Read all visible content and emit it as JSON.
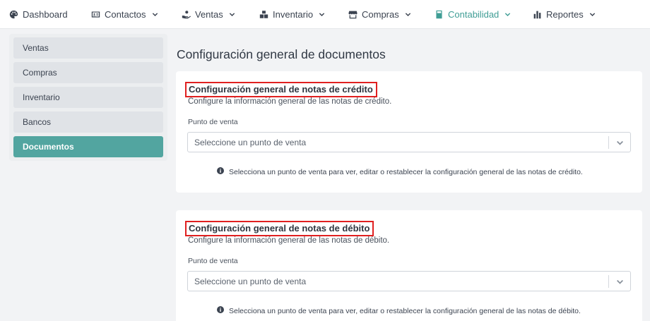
{
  "nav": {
    "items": [
      {
        "label": "Dashboard",
        "icon": "palette-icon",
        "has_dropdown": false
      },
      {
        "label": "Contactos",
        "icon": "contact-card-icon",
        "has_dropdown": true
      },
      {
        "label": "Ventas",
        "icon": "hand-coin-icon",
        "has_dropdown": true
      },
      {
        "label": "Inventario",
        "icon": "boxes-icon",
        "has_dropdown": true
      },
      {
        "label": "Compras",
        "icon": "store-icon",
        "has_dropdown": true
      },
      {
        "label": "Contabilidad",
        "icon": "calculator-icon",
        "has_dropdown": true,
        "active": true
      },
      {
        "label": "Reportes",
        "icon": "bar-chart-icon",
        "has_dropdown": true
      }
    ],
    "active_color": "#3f9d95"
  },
  "sidebar": {
    "items": [
      {
        "label": "Ventas"
      },
      {
        "label": "Compras"
      },
      {
        "label": "Inventario"
      },
      {
        "label": "Bancos"
      },
      {
        "label": "Documentos",
        "active": true
      }
    ],
    "active_color": "#52a5a0"
  },
  "main": {
    "page_title": "Configuración general de documentos",
    "sections": [
      {
        "title": "Configuración general de notas de crédito",
        "description": "Configure la información general de las notas de crédito.",
        "field_label": "Punto de venta",
        "select_placeholder": "Seleccione un punto de venta",
        "info_text": "Selecciona un punto de venta para ver, editar o restablecer la configuración general de las notas de crédito."
      },
      {
        "title": "Configuración general de notas de débito",
        "description": "Configure la información general de las notas de débito.",
        "field_label": "Punto de venta",
        "select_placeholder": "Seleccione un punto de venta",
        "info_text": "Selecciona un punto de venta para ver, editar o restablecer la configuración general de las notas de débito."
      }
    ],
    "highlight_color": "#e02020"
  }
}
